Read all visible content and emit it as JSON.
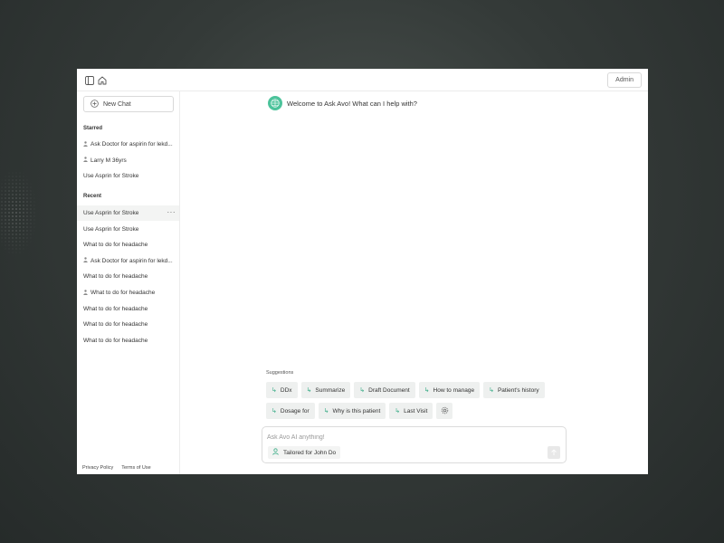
{
  "topbar": {
    "admin_label": "Admin",
    "icons": [
      "sidebar-toggle-icon",
      "home-icon"
    ]
  },
  "sidebar": {
    "new_chat_label": "New Chat",
    "starred_label": "Starred",
    "starred": [
      {
        "label": "Ask Doctor for aspirin for lekd...",
        "person": true
      },
      {
        "label": "Larry M 36yrs",
        "person": true
      },
      {
        "label": "Use Asprin for Stroke",
        "person": false
      }
    ],
    "recent_label": "Recent",
    "recent": [
      {
        "label": "Use Asprin for Stroke",
        "person": false,
        "active": true
      },
      {
        "label": "Use Asprin for Stroke",
        "person": false
      },
      {
        "label": "What to do for headache",
        "person": false
      },
      {
        "label": "Ask Doctor for aspirin for lekd...",
        "person": true
      },
      {
        "label": "What to do for headache",
        "person": false
      },
      {
        "label": "What to do for headache",
        "person": true
      },
      {
        "label": "What to do for headache",
        "person": false
      },
      {
        "label": "What to do for headache",
        "person": false
      },
      {
        "label": "What to do for headache",
        "person": false
      }
    ],
    "footer": {
      "privacy": "Privacy Policy",
      "terms": "Terms of Use"
    }
  },
  "main": {
    "welcome": "Welcome to Ask Avo! What can I help with?",
    "suggestions_label": "Suggestions",
    "suggestions_row1": [
      "DDx",
      "Summarize",
      "Draft Document",
      "How to manage",
      "Patient's history"
    ],
    "suggestions_row2": [
      "Dosage for",
      "Why is this patient",
      "Last Visit"
    ],
    "input_placeholder": "Ask Avo AI anything!",
    "tailored_label": "Tailored for John Do"
  },
  "colors": {
    "accent": "#4cc39b",
    "arrow": "#3fae8a"
  }
}
